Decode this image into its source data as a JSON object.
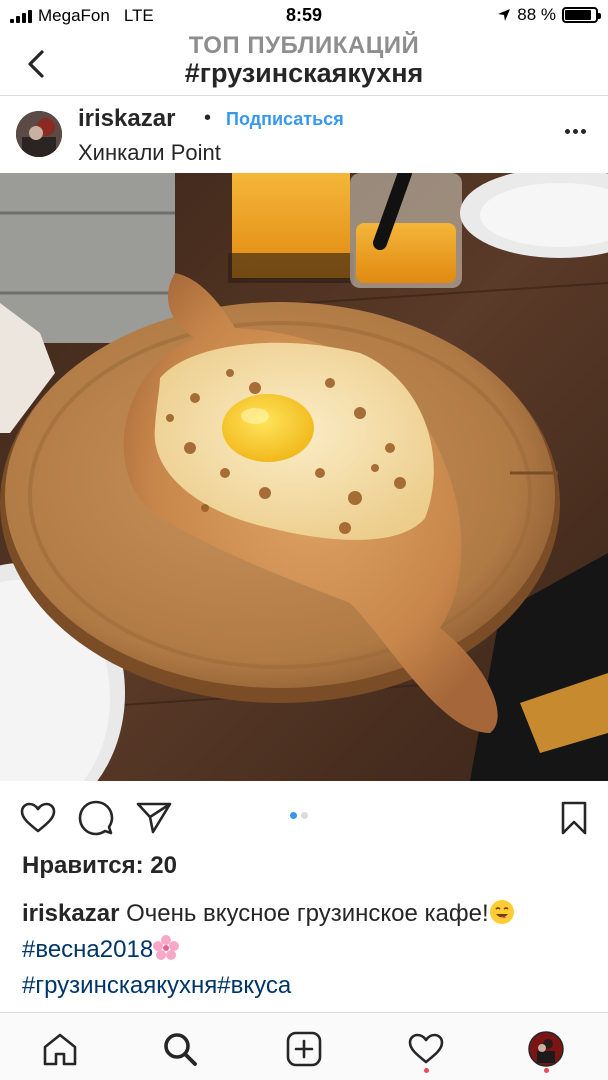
{
  "status_bar": {
    "carrier": "MegaFon",
    "network": "LTE",
    "time": "8:59",
    "battery": "88 %",
    "battery_level": 0.88
  },
  "header": {
    "subtitle": "ТОП ПУБЛИКАЦИЙ",
    "title": "#грузинскаякухня"
  },
  "post": {
    "username": "iriskazar",
    "separator": "•",
    "follow_label": "Подписаться",
    "location": "Хинкали Point",
    "likes": "Нравится: 20",
    "carousel_index": 1,
    "carousel_total": 2,
    "caption": {
      "username": "iriskazar",
      "text1": " Очень вкусное грузинское кафе!",
      "tag1": "#весна2018",
      "tag2": "#грузинскаякухня",
      "tag3": "#вкуса"
    }
  },
  "icons": {
    "back": "chevron-left-icon",
    "more": "more-horizontal-icon",
    "like": "heart-icon",
    "comment": "comment-icon",
    "share": "send-icon",
    "save": "bookmark-icon",
    "tab_home": "home-icon",
    "tab_search": "search-icon",
    "tab_add": "add-post-icon",
    "tab_activity": "heart-icon",
    "tab_profile": "avatar"
  },
  "colors": {
    "link_blue": "#3897f0",
    "hashtag": "#003569",
    "notification": "#ed4956",
    "header_gray": "#8e8e8e"
  }
}
